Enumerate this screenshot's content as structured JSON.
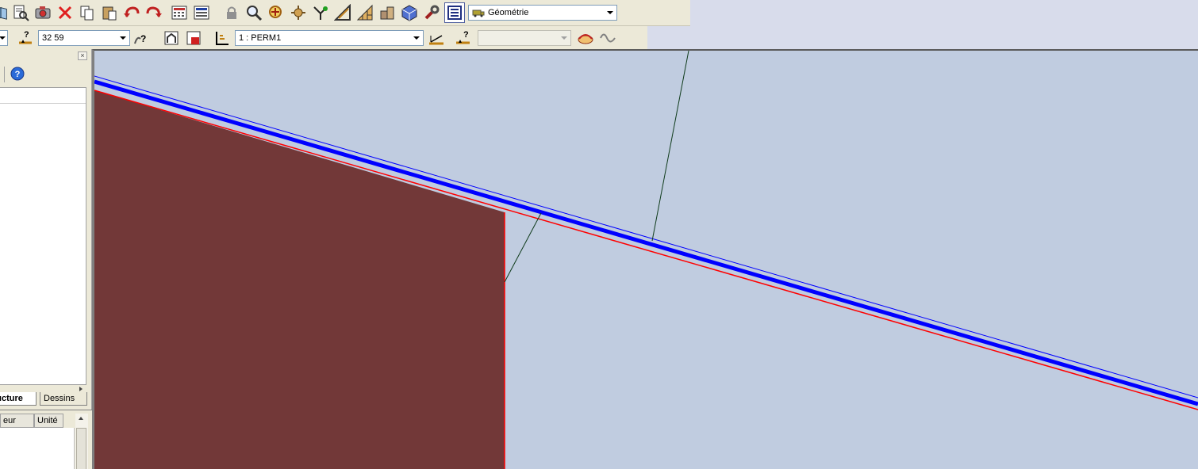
{
  "toolbar_main": {
    "icons": [
      "open-book-icon",
      "document-search-icon",
      "camera-icon",
      "close-red-icon",
      "copy-icon",
      "paste-icon",
      "undo-icon",
      "redo-icon",
      "calculator-icon",
      "calculator-alt-icon",
      "lock-icon",
      "zoom-icon",
      "zoom-target-icon",
      "pan-icon",
      "snap-icon",
      "measure-icon",
      "grid-icon",
      "layers-icon",
      "cube-icon",
      "wrench-icon",
      "view-mode-icon"
    ],
    "geometry_select": "Géométrie"
  },
  "toolbar_second": {
    "value_select": "32 59",
    "perm_select": "1 : PERM1",
    "empty_select": ""
  },
  "left_panel": {
    "close_glyph": "×",
    "tabs": [
      "ructure",
      "Dessins"
    ],
    "props_columns": [
      "eur",
      "Unité"
    ]
  },
  "colors": {
    "canvas_bg": "#c0cce0",
    "solid_fill": "#723838",
    "beam_blue": "#0000ff",
    "edge_red": "#ff0000",
    "guide_green": "#103c1c"
  }
}
